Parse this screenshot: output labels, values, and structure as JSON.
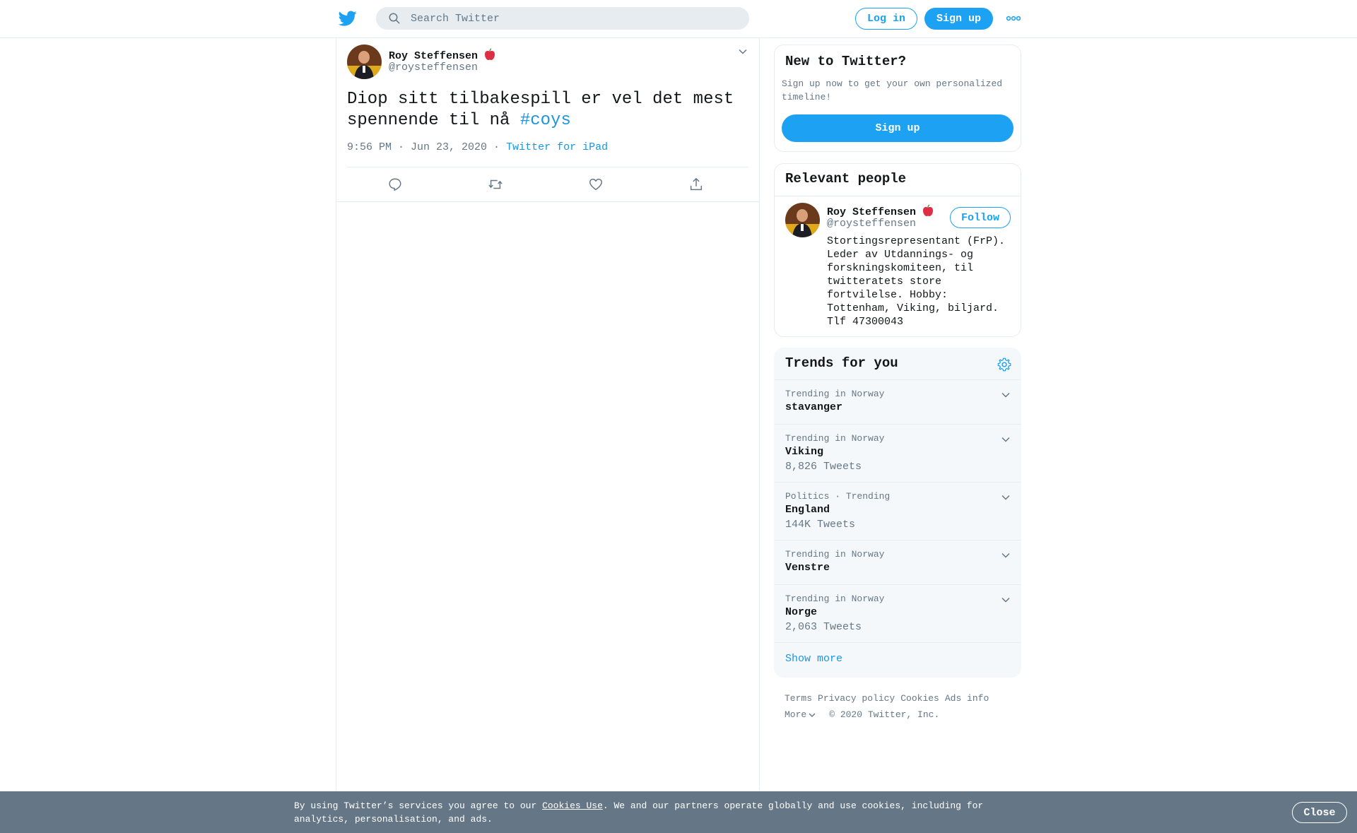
{
  "header": {
    "search_placeholder": "Search Twitter",
    "login_label": "Log in",
    "signup_label": "Sign up"
  },
  "tweet": {
    "author_name": "Roy Steffensen",
    "author_handle": "@roysteffensen",
    "text": "Diop sitt tilbakespill er vel det mest spennende til nå ",
    "hashtag": "#coys",
    "timestamp": "9:56 PM · Jun 23, 2020",
    "separator": " · ",
    "source": "Twitter for iPad"
  },
  "new_to_twitter": {
    "title": "New to Twitter?",
    "description": "Sign up now to get your own personalized timeline!",
    "button_label": "Sign up"
  },
  "relevant_people": {
    "title": "Relevant people",
    "person": {
      "name": "Roy Steffensen",
      "handle": "@roysteffensen",
      "follow_label": "Follow",
      "bio": "Stortingsrepresentant (FrP). Leder av Utdannings- og forskningskomiteen, til twitteratets store fortvilelse. Hobby: Tottenham, Viking, biljard. Tlf 47300043"
    }
  },
  "trends": {
    "title": "Trends for you",
    "items": [
      {
        "context": "Trending in Norway",
        "name": "stavanger",
        "count": ""
      },
      {
        "context": "Trending in Norway",
        "name": "Viking",
        "count": "8,826 Tweets"
      },
      {
        "context": "Politics · Trending",
        "name": "England",
        "count": "144K Tweets"
      },
      {
        "context": "Trending in Norway",
        "name": "Venstre",
        "count": ""
      },
      {
        "context": "Trending in Norway",
        "name": "Norge",
        "count": "2,063 Tweets"
      }
    ],
    "show_more": "Show more"
  },
  "footer": {
    "links": [
      "Terms",
      "Privacy policy",
      "Cookies",
      "Ads info"
    ],
    "more": "More",
    "copyright": "© 2020 Twitter, Inc."
  },
  "cookie_banner": {
    "text_before": "By using Twitter’s services you agree to our ",
    "link": "Cookies Use",
    "text_after": ". We and our partners operate globally and use cookies, including for analytics, personalisation, and ads.",
    "close_label": "Close"
  },
  "colors": {
    "brand_blue": "#1da1f2",
    "link_blue": "#1b95e0",
    "secondary_text": "#657786",
    "border": "#e6ecf0",
    "trends_bg": "#f5f8fa"
  },
  "icons": {
    "logo": "twitter-bird-icon",
    "search": "search-icon",
    "more": "more-dots-icon",
    "verified_emoji": "red-apple-icon",
    "reply": "reply-icon",
    "retweet": "retweet-icon",
    "like": "heart-icon",
    "share": "share-icon",
    "settings": "gear-icon",
    "caret": "chevron-down-icon"
  }
}
